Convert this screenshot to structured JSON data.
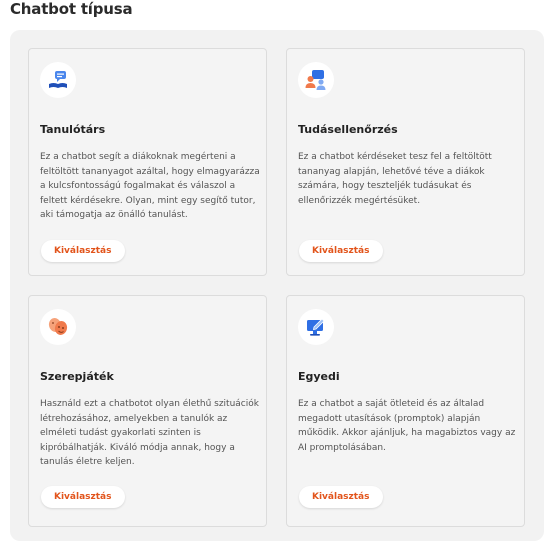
{
  "section": {
    "title": "Chatbot típusa"
  },
  "colors": {
    "accent": "#e2541b",
    "icon_blue": "#2f6fe4",
    "panel_bg": "#f2f2f2"
  },
  "cards": [
    {
      "icon": "book-chat-icon",
      "title": "Tanulótárs",
      "description": "Ez a chatbot segít a diákoknak megérteni a feltöltött tananyagot azáltal, hogy elmagyarázza a kulcsfontosságú fogalmakat és válaszol a feltett kérdésekre. Olyan, mint egy segítő tutor, aki támogatja az önálló tanulást.",
      "button": "Kiválasztás"
    },
    {
      "icon": "quiz-users-icon",
      "title": "Tudásellenőrzés",
      "description": "Ez a chatbot kérdéseket tesz fel a feltöltött tananyag alapján, lehetővé téve a diákok számára, hogy teszteljék tudásukat és ellenőrizzék megértésüket.",
      "button": "Kiválasztás"
    },
    {
      "icon": "theater-masks-icon",
      "title": "Szerepjáték",
      "description": "Használd ezt a chatbotot olyan élethű szituációk létrehozásához, amelyekben a tanulók az elméleti tudást gyakorlati szinten is kipróbálhatják. Kiváló módja annak, hogy a tanulás életre keljen.",
      "button": "Kiválasztás"
    },
    {
      "icon": "custom-edit-monitor-icon",
      "title": "Egyedi",
      "description": "Ez a chatbot a saját ötleteid és az általad megadott utasítások (promptok) alapján működik. Akkor ajánljuk, ha magabiztos vagy az AI promptolásában.",
      "button": "Kiválasztás"
    }
  ]
}
